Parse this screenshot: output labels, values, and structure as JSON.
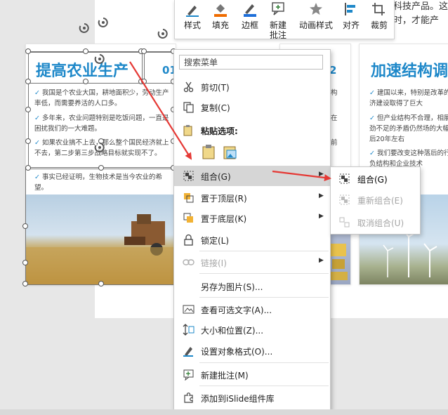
{
  "ribbon": {
    "buttons": [
      {
        "label": "样式",
        "icon": "pen-style-icon"
      },
      {
        "label": "填充",
        "icon": "paint-bucket-icon"
      },
      {
        "label": "边框",
        "icon": "pen-border-icon"
      },
      {
        "label": "新建\n批注",
        "icon": "new-comment-icon"
      },
      {
        "label": "动画样式",
        "icon": "star-animation-icon"
      },
      {
        "label": "对齐",
        "icon": "align-icon"
      },
      {
        "label": "裁剪",
        "icon": "crop-icon"
      }
    ]
  },
  "slide": {
    "top_right_text": [
      "科技产品。这",
      "时，才能产"
    ],
    "card1": {
      "title": "提高农业生产",
      "number": "01",
      "bullets": [
        "我国是个农业大国，耕地面积少，劳动生产率低，而需要养活的人口多。",
        "多年来，农业问题特别是吃饭问题，一直是困扰我们的一大难题。",
        "如果农业搞不上去，那么整个国民经济就上不去，第二步第三步战略目标就实现不了。",
        "事实已经证明，生物技术是当今农业的希望。"
      ]
    },
    "card2": {
      "number": "2",
      "bullets_partial": [
        "构",
        "在",
        "前"
      ]
    },
    "card3": {
      "title": "加速结构调",
      "bullets": [
        "建国以来，特别是改革的经济建设取得了巨大",
        "但产业结构不合理，相展后劲不足的矛盾仍然场的大幅落后20年左右",
        "我们要改变这种落后的行JJ负结构和企业技术"
      ]
    }
  },
  "context_menu": {
    "search_placeholder": "搜索菜单",
    "items": {
      "cut": "剪切(T)",
      "copy": "复制(C)",
      "paste_options": "粘贴选项:",
      "group": "组合(G)",
      "bring_front": "置于顶层(R)",
      "send_back": "置于底层(K)",
      "lock": "锁定(L)",
      "link": "链接(I)",
      "save_as_picture": "另存为图片(S)...",
      "alt_text": "查看可选文字(A)...",
      "size_position": "大小和位置(Z)...",
      "format_object": "设置对象格式(O)...",
      "new_comment": "新建批注(M)",
      "add_islide": "添加到iSlide组件库"
    }
  },
  "submenu": {
    "group": "组合(G)",
    "regroup": "重新组合(E)",
    "ungroup": "取消组合(U)"
  },
  "colors": {
    "accent_blue": "#1e88c9",
    "annotation_red": "#e53935",
    "menu_highlight": "#d6d6d6",
    "disabled_text": "#a6a6a6"
  }
}
